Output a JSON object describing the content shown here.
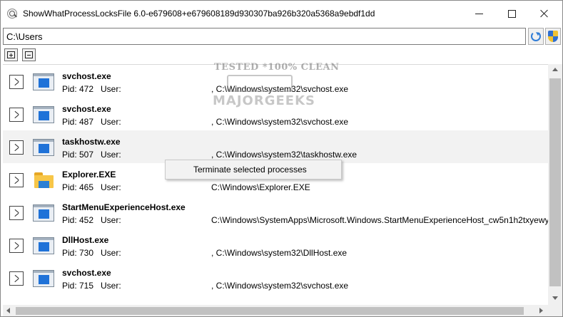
{
  "window": {
    "title": "ShowWhatProcessLocksFile 6.0-e679608+e679608189d930307ba926b320a5368a9ebdf1dd"
  },
  "toolbar": {
    "path_value": "C:\\Users"
  },
  "watermark": {
    "line1": "TESTED *100% CLEAN",
    "line2": "MAJORGEEKS"
  },
  "processes": [
    {
      "name": "svchost.exe",
      "pid": "Pid: 472",
      "user": "User:",
      "path": ", C:\\Windows\\system32\\svchost.exe",
      "icon": "window-icon"
    },
    {
      "name": "svchost.exe",
      "pid": "Pid: 487",
      "user": "User:",
      "path": ", C:\\Windows\\system32\\svchost.exe",
      "icon": "window-icon"
    },
    {
      "name": "taskhostw.exe",
      "pid": "Pid: 507",
      "user": "User:",
      "path": ", C:\\Windows\\system32\\taskhostw.exe",
      "icon": "window-icon"
    },
    {
      "name": "Explorer.EXE",
      "pid": "Pid: 465",
      "user": "User:",
      "path": "C:\\Windows\\Explorer.EXE",
      "icon": "folder-icon"
    },
    {
      "name": "StartMenuExperienceHost.exe",
      "pid": "Pid: 452",
      "user": "User:",
      "path": "C:\\Windows\\SystemApps\\Microsoft.Windows.StartMenuExperienceHost_cw5n1h2txyewy",
      "icon": "window-icon"
    },
    {
      "name": "DllHost.exe",
      "pid": "Pid: 730",
      "user": "User:",
      "path": ", C:\\Windows\\system32\\DllHost.exe",
      "icon": "window-icon"
    },
    {
      "name": "svchost.exe",
      "pid": "Pid: 715",
      "user": "User:",
      "path": ", C:\\Windows\\system32\\svchost.exe",
      "icon": "window-icon"
    }
  ],
  "context_menu": {
    "item_label": "Terminate selected processes"
  }
}
